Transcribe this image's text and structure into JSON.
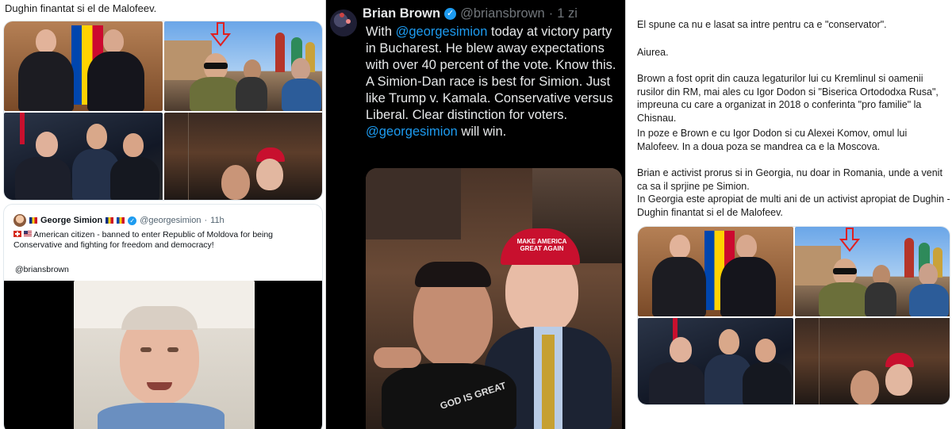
{
  "left": {
    "top_caption": "Dughin finantat si el de Malofeev.",
    "tweet": {
      "name": "George Simion",
      "handle": "@georgesimion",
      "time": "11h",
      "text": "American citizen - banned to enter Republic of Moldova for being Conservative and fighting for freedom and democracy!",
      "mention": "@briansbrown"
    }
  },
  "middle": {
    "name": "Brian Brown",
    "handle": "@briansbrown",
    "time": "1 zi",
    "body_parts": {
      "t1": "With ",
      "m1": "@georgesimion",
      "t2": " today at victory party in Bucharest. He blew away expectations with over 40 percent of the vote. Know this. A Simion-Dan race is best for Simion. Just like Trump v. Kamala. Conservative versus Liberal. Clear distinction for voters. ",
      "m2": "@georgesimion",
      "t3": " will win."
    },
    "cap_text": "MAKE AMERICA GREAT AGAIN",
    "shirt_text": "GOD IS GREAT"
  },
  "right": {
    "p1": "El spune ca nu e lasat sa intre pentru ca e \"conservator\".",
    "p2": "Aiurea.",
    "p3": "Brown a fost oprit din cauza legaturilor lui cu Kremlinul si oamenii rusilor din RM, mai ales cu Igor Dodon si \"Biserica Ortododxa Rusa\", impreuna cu care a organizat in 2018 o conferinta \"pro familie\" la Chisnau.",
    "p4": "In poze e Brown e cu Igor Dodon si  cu Alexei Komov, omul lui Malofeev. In a doua poza se mandrea ca e la Moscova.",
    "p5": "Brian e activist prorus si in Georgia, nu doar in Romania, unde a venit ca sa il sprjine pe Simion.",
    "p6": "In Georgia este apropiat de multi ani de un activist apropiat de Dughin - Dughin finantat si el de Malofeev."
  },
  "icons": [
    "verified-icon",
    "flag-romania-icon",
    "flag-moldova-icon",
    "flag-us-icon",
    "flag-switzerland-icon",
    "red-arrow-icon"
  ],
  "colors": {
    "twitter_blue": "#1d9bf0",
    "dark_bg": "#000000",
    "maga_red": "#c8102e"
  }
}
